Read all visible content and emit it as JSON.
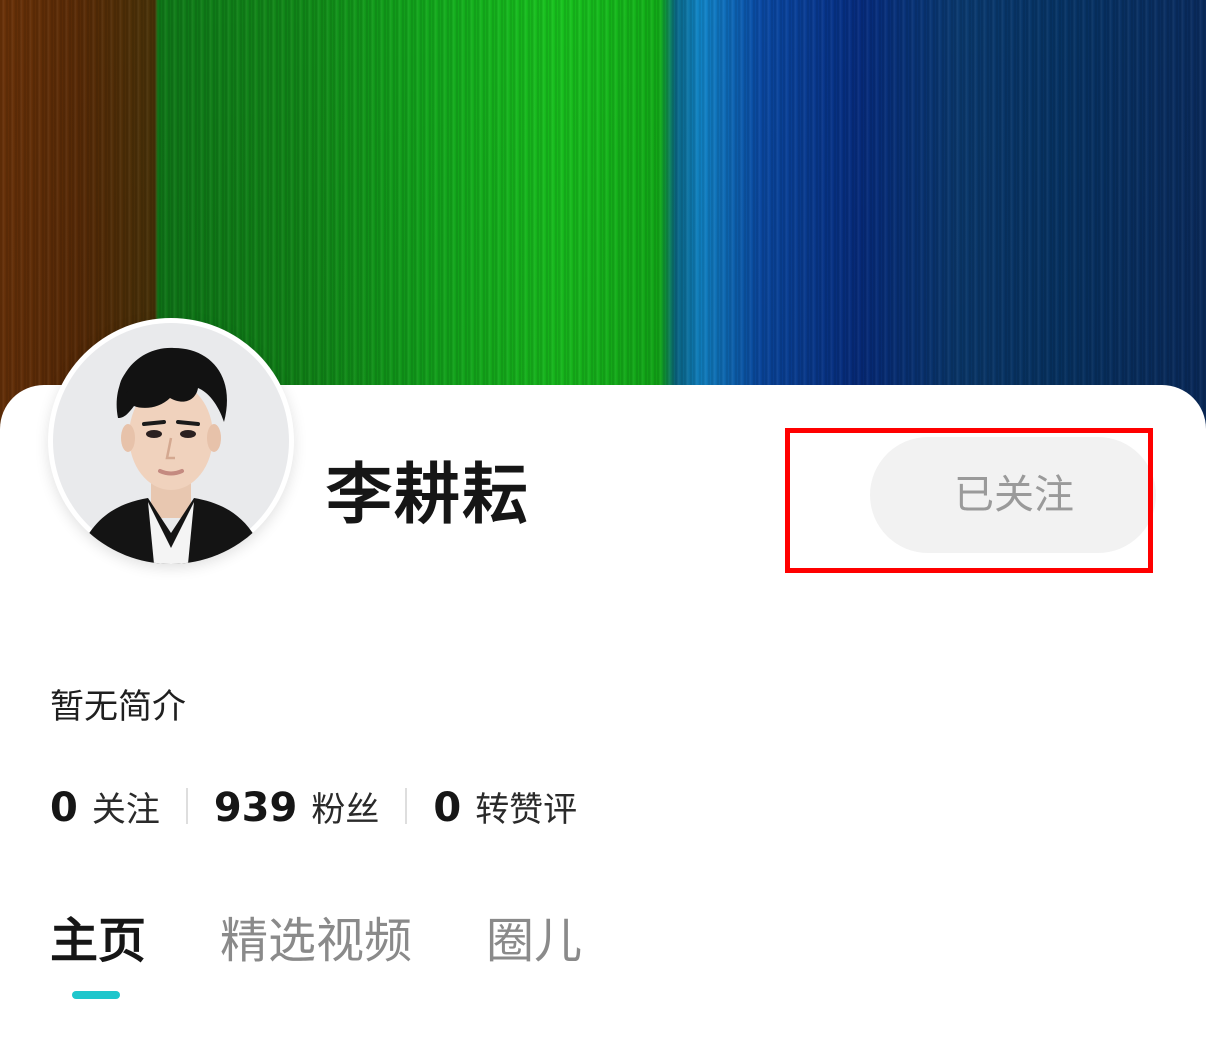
{
  "profile": {
    "name": "李耕耘",
    "follow_button_label": "已关注",
    "bio": "暂无简介"
  },
  "stats": [
    {
      "value": "0",
      "label": "关注"
    },
    {
      "value": "939",
      "label": "粉丝"
    },
    {
      "value": "0",
      "label": "转赞评"
    }
  ],
  "tabs": [
    {
      "label": "主页",
      "active": true
    },
    {
      "label": "精选视频",
      "active": false
    },
    {
      "label": "圈儿",
      "active": false
    }
  ],
  "colors": {
    "accent": "#1ec6cc",
    "highlight": "#ff0000",
    "follow_button_bg": "#f2f2f2",
    "follow_button_text": "#9a9a9a"
  },
  "icons": {
    "avatar": "user-avatar-photo"
  }
}
